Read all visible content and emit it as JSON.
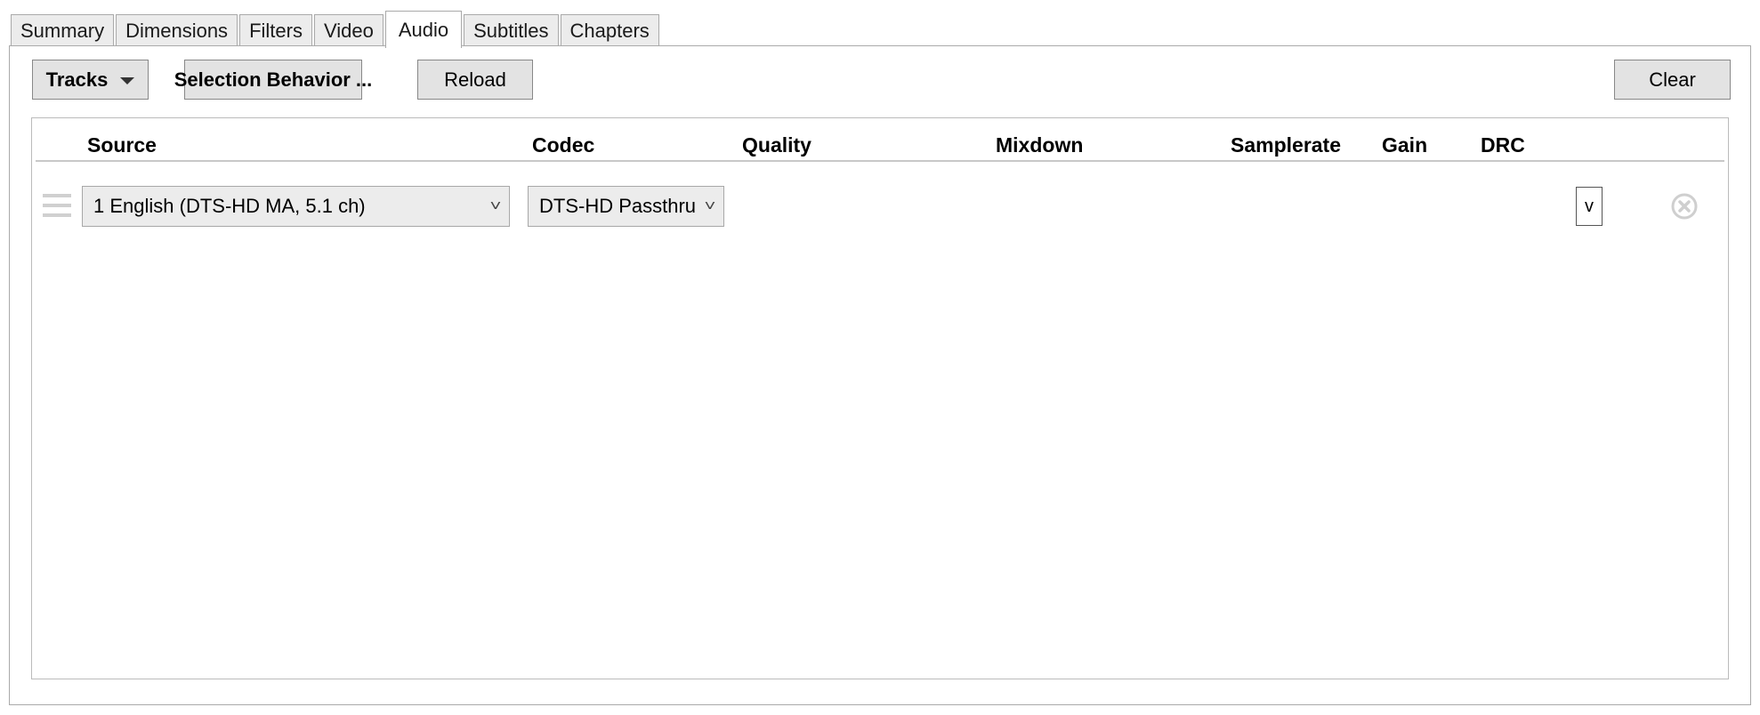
{
  "tabs": [
    "Summary",
    "Dimensions",
    "Filters",
    "Video",
    "Audio",
    "Subtitles",
    "Chapters"
  ],
  "active_tab": "Audio",
  "toolbar": {
    "tracks_label": "Tracks",
    "selection_behavior_label": "Selection Behavior ...",
    "reload_label": "Reload",
    "clear_label": "Clear"
  },
  "columns": {
    "source": "Source",
    "codec": "Codec",
    "quality": "Quality",
    "mixdown": "Mixdown",
    "samplerate": "Samplerate",
    "gain": "Gain",
    "drc": "DRC"
  },
  "tracks": [
    {
      "source": "1 English (DTS-HD MA, 5.1 ch)",
      "codec": "DTS-HD Passthru",
      "toggle_label": "v"
    }
  ],
  "icons": {
    "drag": "drag-handle-icon",
    "remove": "remove-track-icon",
    "dropdown": "chevron-down-icon"
  }
}
